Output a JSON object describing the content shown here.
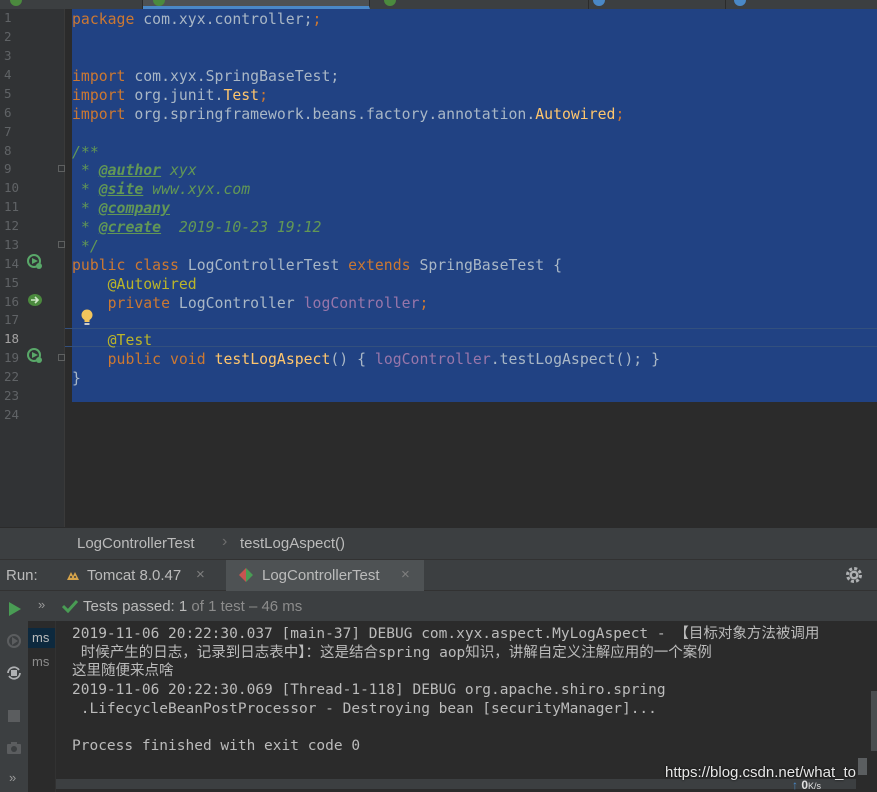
{
  "colors": {
    "accent": "#4a88c7",
    "selection": "#214283",
    "pass_green": "#499c54",
    "run_green": "#59a869",
    "keyword": "#cc7832",
    "comment": "#629755",
    "annotation": "#bbb529",
    "field": "#9876aa",
    "method": "#ffc66d"
  },
  "editor": {
    "line_numbers": [
      "1",
      "2",
      "3",
      "4",
      "5",
      "6",
      "7",
      "8",
      "9",
      "10",
      "11",
      "12",
      "13",
      "14",
      "15",
      "16",
      "17",
      "18",
      "19",
      "22",
      "23",
      "24"
    ],
    "current_line": "18",
    "gutter_icons": [
      "run-test-class-icon",
      "bean-autowired-icon",
      "run-test-method-icon"
    ],
    "lines": {
      "l1_kw": "package",
      "l1_rest": " com.xyx.controller;",
      "l4_kw": "import",
      "l4_rest": " com.xyx.SpringBaseTest;",
      "l5_kw": "import",
      "l5_pkg": " org.junit.",
      "l5_cls": "Test",
      "l5_semi": ";",
      "l6_kw": "import",
      "l6_pkg": " org.springframework.beans.factory.annotation.",
      "l6_cls": "Autowired",
      "l6_semi": ";",
      "l8": "/**",
      "l9_pre": " * ",
      "l9_tag": "@author",
      "l9_val": " xyx",
      "l10_pre": " * ",
      "l10_tag": "@site",
      "l10_val": " www.xyx.com",
      "l11_pre": " * ",
      "l11_tag": "@company",
      "l12_pre": " * ",
      "l12_tag": "@create",
      "l12_val": "  2019-10-23 19:12",
      "l13": " */",
      "l14_kw1": "public class",
      "l14_name": " LogControllerTest ",
      "l14_kw2": "extends",
      "l14_base": " SpringBaseTest {",
      "l15_ann": "    @Autowired",
      "l16_kw": "    private",
      "l16_type": " LogController ",
      "l16_field": "logController",
      "l16_semi": ";",
      "l18_ann": "    @Test",
      "l19_kw": "    public void",
      "l19_sp": " ",
      "l19_name": "testLogAspect",
      "l19_open": "() { ",
      "l19_field": "logController",
      "l19_call": ".testLogAspect(); }",
      "l22": "}"
    }
  },
  "breadcrumb": {
    "items": [
      "LogControllerTest",
      "testLogAspect()"
    ],
    "separator": "›"
  },
  "run": {
    "label": "Run:",
    "tabs": [
      {
        "label": "Tomcat 8.0.47",
        "close": "×",
        "icon": "tomcat-icon"
      },
      {
        "label": "LogControllerTest",
        "close": "×",
        "icon": "junit-icon"
      }
    ],
    "settings_icon": "gear-icon"
  },
  "tests": {
    "expand": "»",
    "passed_label": "Tests passed:",
    "passed_count": "1",
    "passed_detail": "of 1 test – 46 ms"
  },
  "tree": {
    "rows": [
      "ms",
      "ms"
    ]
  },
  "console": {
    "lines": [
      "2019-11-06 20:22:30.037 [main-37] DEBUG com.xyx.aspect.MyLogAspect - 【目标对象方法被调用",
      " 时候产生的日志，记录到日志表中】：这是结合spring aop知识，讲解自定义注解应用的一个案例",
      "这里随便来点啥",
      "2019-11-06 20:22:30.069 [Thread-1-118] DEBUG org.apache.shiro.spring",
      " .LifecycleBeanPostProcessor - Destroying bean [securityManager]...",
      "",
      "Process finished with exit code 0"
    ]
  },
  "watermark": "https://blog.csdn.net/what_to",
  "net_speed": {
    "arrow": "↑",
    "value": "0",
    "unit": "K/s"
  }
}
